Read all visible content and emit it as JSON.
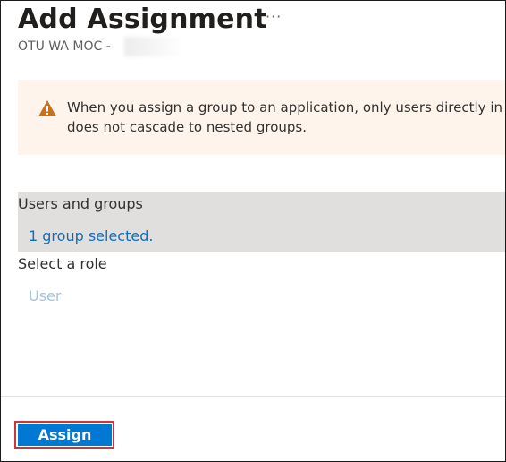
{
  "header": {
    "title": "Add Assignment",
    "more_label": "···",
    "subtitle": "OTU WA MOC - "
  },
  "warning": {
    "icon": "warning-icon",
    "icon_color": "#c7711c",
    "line1": "When you assign a group to an application, only users directly in the",
    "line2": "does not cascade to nested groups."
  },
  "users_and_groups": {
    "label": "Users and groups",
    "value": "1 group selected."
  },
  "role": {
    "label": "Select a role",
    "value": "User"
  },
  "footer": {
    "assign_label": "Assign"
  },
  "colors": {
    "primary": "#0078d4",
    "link": "#0f6cbd",
    "warning_bg": "#fff4ec",
    "highlight_outline": "#d13438"
  }
}
